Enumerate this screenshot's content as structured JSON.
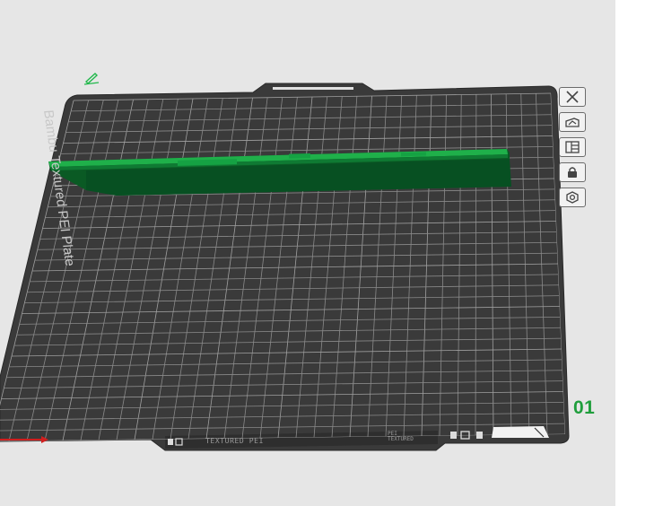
{
  "plate": {
    "number_label": "01",
    "name_label": "Bambu Textured PEI Plate",
    "bottom_strip_text": "TEXTURED PEI",
    "bottom_strip_small": "PEI\nTEXTURED"
  },
  "plate_toolbar": {
    "icons": [
      "close-icon",
      "auto-orient-icon",
      "arrange-icon",
      "lock-icon",
      "settings-icon"
    ]
  },
  "colors": {
    "viewport_background": "#e6e6e6",
    "plate_surface": "#3c3c3c",
    "grid_line": "#8a8a8a",
    "model_green": "#0a6b2b",
    "model_highlight": "#22b84c",
    "plate_number_green": "#1f9e3c",
    "axis_red": "#d11f1f"
  }
}
